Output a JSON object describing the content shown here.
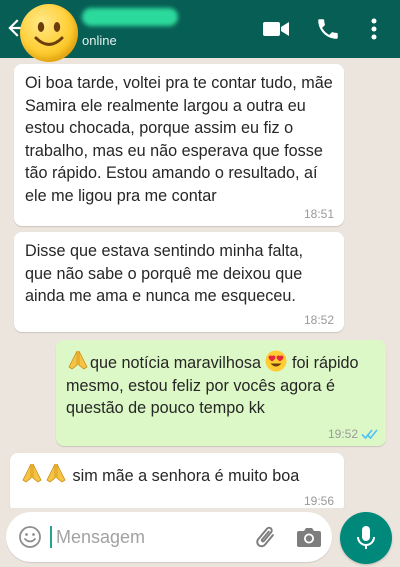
{
  "header": {
    "status": "online",
    "icons": [
      "back-arrow-icon",
      "avatar-emoji",
      "video-call-icon",
      "phone-icon",
      "menu-dots-icon"
    ],
    "colors": {
      "header_bg": "#075e54",
      "chat_bg": "#ece5dd",
      "outgoing_bubble": "#dcf8c6",
      "incoming_bubble": "#ffffff",
      "accent": "#00897b",
      "read_ticks": "#4fc3f7"
    }
  },
  "messages": [
    {
      "direction": "incoming",
      "text": "Oi boa tarde, voltei pra te contar tudo, mãe Samira ele realmente largou a outra eu estou chocada, porque assim eu fiz o trabalho, mas eu não esperava que fosse tão rápido. Estou amando o resultado, aí ele me ligou pra me contar",
      "time": "18:51"
    },
    {
      "direction": "incoming",
      "text": "Disse que estava sentindo minha falta, que não sabe o porquê me deixou que ainda me ama e nunca me esqueceu.",
      "time": "18:52"
    },
    {
      "direction": "outgoing",
      "text_a": "que notícia maravilhosa",
      "text_b": "foi rápido mesmo, estou feliz por vocês agora é questão de pouco tempo kk",
      "time": "19:52",
      "status": "read"
    },
    {
      "direction": "incoming",
      "text": "sim mãe a senhora é muito boa",
      "time": "19:56"
    }
  ],
  "input": {
    "placeholder": "Mensagem",
    "value": ""
  }
}
